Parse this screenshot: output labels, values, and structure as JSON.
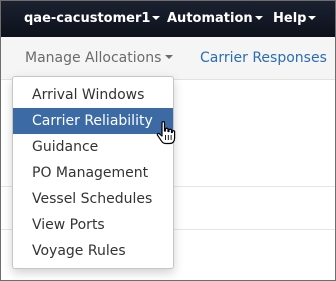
{
  "topnav": {
    "user": "qae-cacustomer1",
    "automation": "Automation",
    "help": "Help"
  },
  "subnav": {
    "manage_allocations": "Manage Allocations",
    "carrier_responses": "Carrier Responses"
  },
  "dropdown": {
    "items": [
      {
        "label": "Arrival Windows"
      },
      {
        "label": "Carrier Reliability",
        "active": true
      },
      {
        "label": "Guidance"
      },
      {
        "label": "PO Management"
      },
      {
        "label": "Vessel Schedules"
      },
      {
        "label": "View Ports"
      },
      {
        "label": "Voyage Rules"
      }
    ]
  },
  "colors": {
    "topbar": "#111723",
    "active_item": "#3c6aa5",
    "link": "#2a6db3"
  },
  "cursor": {
    "icon": "hand-pointer-icon"
  }
}
